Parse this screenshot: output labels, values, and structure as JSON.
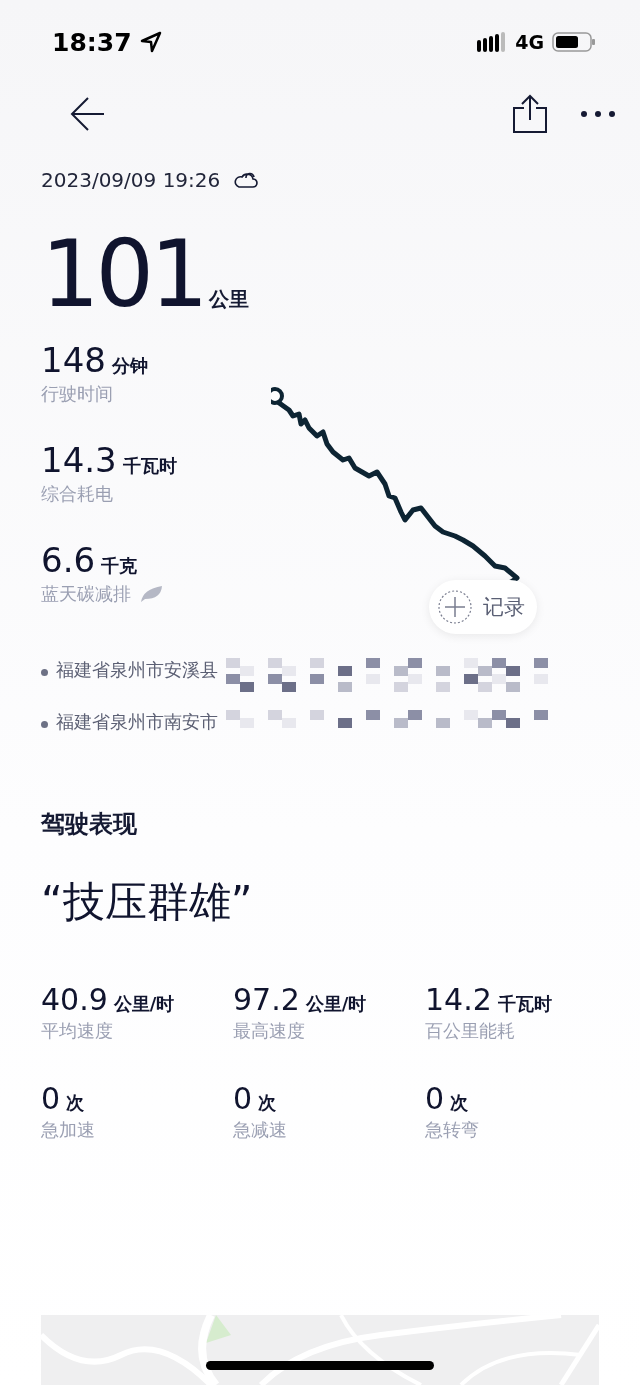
{
  "status_bar": {
    "time": "18:37",
    "network": "4G"
  },
  "trip": {
    "datetime": "2023/09/09 19:26",
    "distance": {
      "value": "101",
      "unit": "公里"
    },
    "stats": [
      {
        "value": "148",
        "unit": "分钟",
        "label": "行驶时间",
        "kind": "plain"
      },
      {
        "value": "14.3",
        "unit": "千瓦时",
        "label": "综合耗电",
        "kind": "plain"
      },
      {
        "value": "6.6",
        "unit": "千克",
        "label": "蓝天碳减排",
        "kind": "eco"
      }
    ],
    "record_button": {
      "label": "记录"
    },
    "addresses": [
      {
        "text": "福建省泉州市安溪县",
        "redaction_wraps": true
      },
      {
        "text": "福建省泉州市南安市",
        "redaction_wraps": false
      }
    ]
  },
  "driving": {
    "title": "驾驶表现",
    "rating": "“技压群雄”",
    "metrics": [
      {
        "value": "40.9",
        "unit": "公里/时",
        "label": "平均速度"
      },
      {
        "value": "97.2",
        "unit": "公里/时",
        "label": "最高速度"
      },
      {
        "value": "14.2",
        "unit": "千瓦时",
        "label": "百公里能耗"
      },
      {
        "value": "0",
        "unit": "次",
        "label": "急加速"
      },
      {
        "value": "0",
        "unit": "次",
        "label": "急减速"
      },
      {
        "value": "0",
        "unit": "次",
        "label": "急转弯"
      }
    ]
  }
}
